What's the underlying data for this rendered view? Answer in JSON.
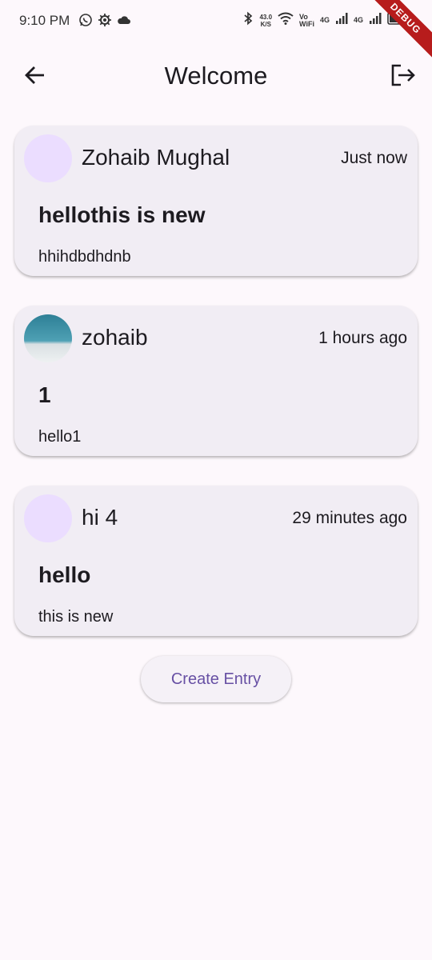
{
  "status_bar": {
    "time": "9:10 PM",
    "speed_value": "43.0",
    "speed_unit": "K/S",
    "vowifi_top": "Vo",
    "vowifi_bottom": "WiFi",
    "net1": "4G",
    "net2": "4G",
    "debug_label": "DEBUG"
  },
  "app_bar": {
    "title": "Welcome",
    "back_icon": "arrow-left-icon",
    "logout_icon": "logout-icon"
  },
  "entries": [
    {
      "author": "Zohaib Mughal",
      "time": "Just now",
      "title": "hellothis is new",
      "body": "hhihdbdhdnb",
      "avatar": "placeholder"
    },
    {
      "author": "zohaib",
      "time": "1 hours ago",
      "title": "1",
      "body": "hello1",
      "avatar": "photo"
    },
    {
      "author": "hi 4",
      "time": "29 minutes ago",
      "title": "hello",
      "body": "this is new",
      "avatar": "placeholder"
    }
  ],
  "create_button": {
    "label": "Create Entry"
  },
  "colors": {
    "background": "#fdf8fc",
    "card": "#f1edf4",
    "accent": "#6750a4",
    "avatar_placeholder": "#ebddff"
  }
}
